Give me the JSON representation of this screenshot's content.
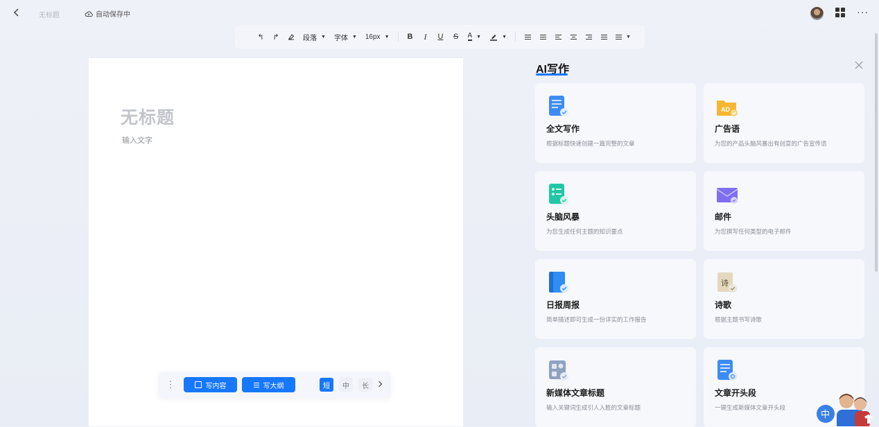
{
  "topbar": {
    "doc_title": "无标题",
    "autosave": "自动保存中"
  },
  "toolbar": {
    "paragraph": "段落",
    "font": "字体",
    "size": "16px",
    "bold": "B",
    "italic": "I",
    "underline": "U",
    "strike": "S",
    "font_color": "A"
  },
  "editor": {
    "title_placeholder": "无标题",
    "body_placeholder": "输入文字"
  },
  "writebar": {
    "write_content": "写内容",
    "write_outline": "写大纲",
    "length_short": "短",
    "length_medium": "中",
    "length_long": "长",
    "selected_length": "短"
  },
  "ai_panel": {
    "title": "AI写作",
    "cards": [
      {
        "name": "全文写作",
        "desc": "根据标题快速创建一篇完整的文章",
        "icon": "document-write-icon",
        "color": "#3d8cf5"
      },
      {
        "name": "广告语",
        "desc": "为您的产品头脑风暴出有创意的广告宣传语",
        "icon": "ad-icon",
        "color": "#f5b731"
      },
      {
        "name": "头脑风暴",
        "desc": "为您生成任何主题的知识要点",
        "icon": "brainstorm-icon",
        "color": "#22c7a5"
      },
      {
        "name": "邮件",
        "desc": "为您撰写任何类型的电子邮件",
        "icon": "mail-icon",
        "color": "#7f6ff0"
      },
      {
        "name": "日报周报",
        "desc": "简单描述即可生成一份详实的工作报告",
        "icon": "report-book-icon",
        "color": "#2f8df3"
      },
      {
        "name": "诗歌",
        "desc": "根据主题书写诗歌",
        "icon": "poem-icon",
        "color": "#c9b48a",
        "glyph": "诗"
      },
      {
        "name": "新媒体文章标题",
        "desc": "输入关键词生成引人入胜的文章标题",
        "icon": "media-title-icon",
        "color": "#8fa2c0"
      },
      {
        "name": "文章开头段",
        "desc": "一键生成新媒体文章开头段",
        "icon": "article-intro-icon",
        "color": "#3d8cf5"
      }
    ]
  },
  "mascot": {
    "badge": "中"
  }
}
